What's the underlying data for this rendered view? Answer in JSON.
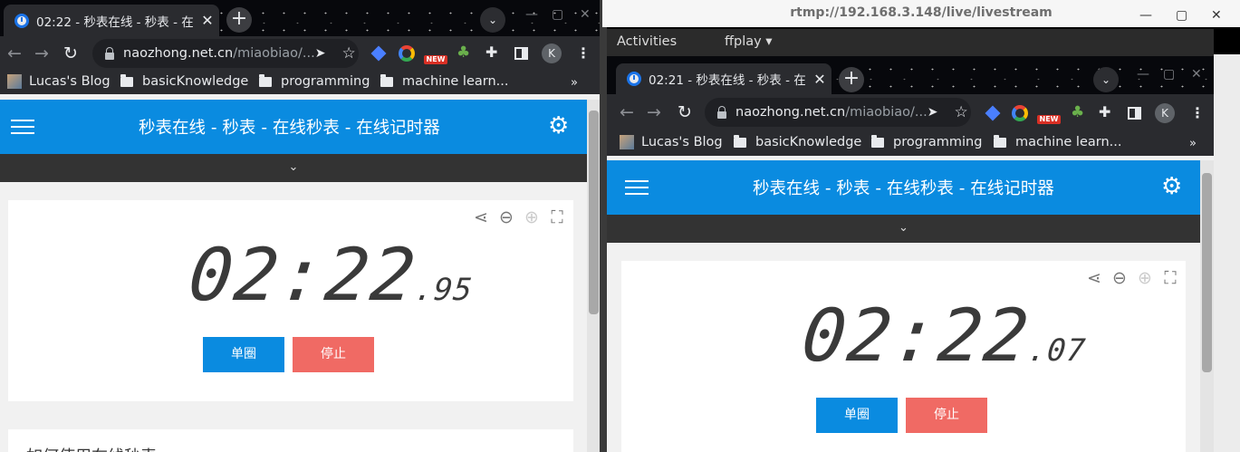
{
  "left": {
    "tab_title": "02:22 - 秒表在线 - 秒表 - 在",
    "url_domain": "naozhong.net.cn",
    "url_path": "/miaobiao/...",
    "bookmarks": [
      "Lucas's Blog",
      "basicKnowledge",
      "programming",
      "machine learn..."
    ],
    "ext_new_badge": "NEW",
    "avatar": "K",
    "header_title": "秒表在线 - 秒表 - 在线秒表 - 在线记时器",
    "time_main": "02:22",
    "time_ms": ".95",
    "lap_button": "单圈",
    "stop_button": "停止",
    "section_heading": "如何使用在线秒表"
  },
  "ffplay": {
    "window_title": "rtmp://192.168.3.148/live/livestream",
    "activities": "Activities",
    "app_menu": "ffplay ▾"
  },
  "right": {
    "tab_title": "02:21 - 秒表在线 - 秒表 - 在",
    "url_domain": "naozhong.net.cn",
    "url_path": "/miaobiao/...",
    "bookmarks": [
      "Lucas's Blog",
      "basicKnowledge",
      "programming",
      "machine learn..."
    ],
    "ext_new_badge": "NEW",
    "avatar": "K",
    "header_title": "秒表在线 - 秒表 - 在线秒表 - 在线记时器",
    "time_main": "02:22",
    "time_ms": ".07",
    "lap_button": "单圈",
    "stop_button": "停止"
  },
  "icons": {
    "back": "←",
    "forward": "→",
    "reload": "↻",
    "send": "➤",
    "star": "☆",
    "share": "⋖",
    "zoom_out": "⊖",
    "zoom_in": "⊕",
    "fullscreen": "⛶",
    "chevron": "⌄",
    "gear": "⚙",
    "close": "✕",
    "plus": "+",
    "more": "»",
    "kebab": "⋮"
  },
  "colors": {
    "header_blue": "#0a8be0",
    "stop_red": "#f06a64",
    "lap_blue": "#0a8be0",
    "subbar": "#333333"
  }
}
